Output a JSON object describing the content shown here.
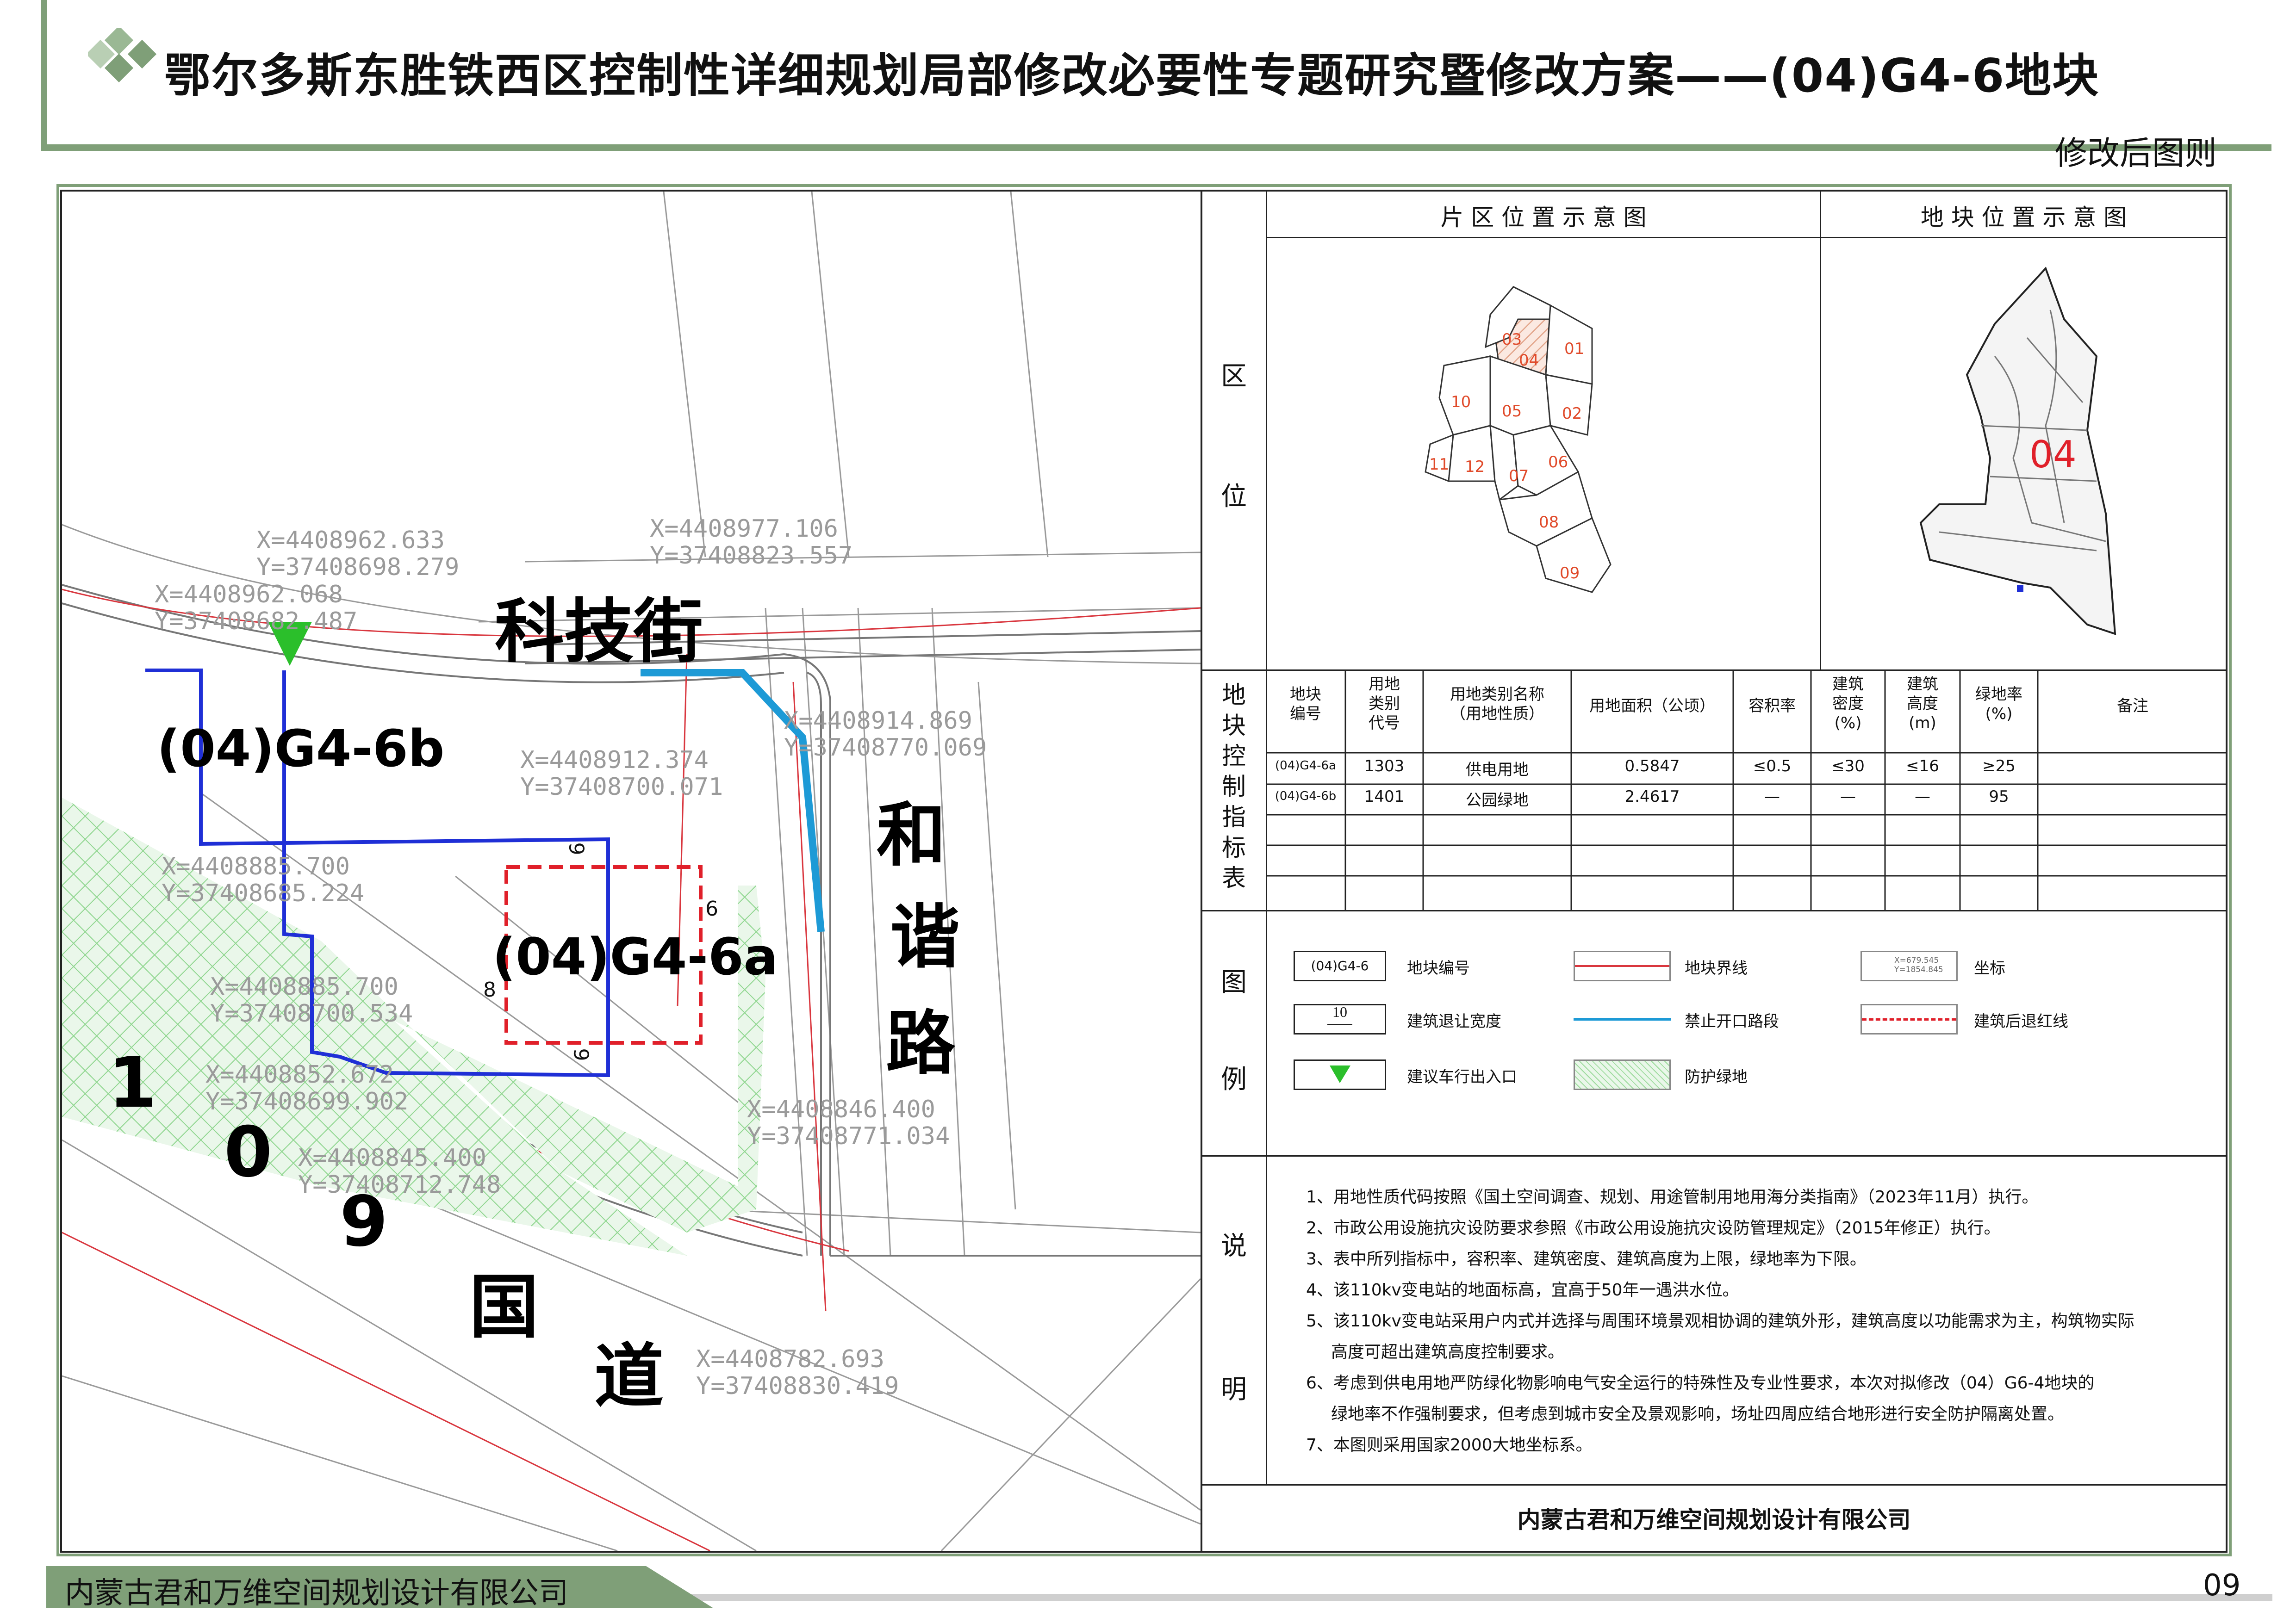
{
  "header": {
    "title": "鄂尔多斯东胜铁西区控制性详细规划局部修改必要性专题研究暨修改方案——(04)G4-6地块",
    "subtitle": "修改后图则"
  },
  "map": {
    "roads": {
      "keji": "科技街",
      "hexie": [
        "和",
        "谐",
        "路"
      ],
      "guodao": [
        "1",
        "0",
        "9",
        "国",
        "道"
      ]
    },
    "parcels": {
      "a": "(04)G4-6a",
      "b": "(04)G4-6b"
    },
    "setbacks": {
      "top": "6",
      "right": "6",
      "left": "8",
      "bottom": "6"
    },
    "coordinates": [
      {
        "x": "X=4408962.633",
        "y": "Y=37408698.279"
      },
      {
        "x": "X=4408977.106",
        "y": "Y=37408823.557"
      },
      {
        "x": "X=4408962.068",
        "y": "Y=37408682.487"
      },
      {
        "x": "X=4408914.869",
        "y": "Y=37408770.069"
      },
      {
        "x": "X=4408912.374",
        "y": "Y=37408700.071"
      },
      {
        "x": "X=4408885.700",
        "y": "Y=37408685.224"
      },
      {
        "x": "X=4408885.700",
        "y": "Y=37408700.534"
      },
      {
        "x": "X=4408852.672",
        "y": "Y=37408699.902"
      },
      {
        "x": "X=4408846.400",
        "y": "Y=37408771.034"
      },
      {
        "x": "X=4408845.400",
        "y": "Y=37408712.748"
      },
      {
        "x": "X=4408782.693",
        "y": "Y=37408830.419"
      }
    ]
  },
  "location": {
    "section_label": [
      "区",
      "位"
    ],
    "district_title": "片 区 位 置 示 意 图",
    "plot_title": "地 块 位 置 示 意 图",
    "district_zones": [
      "03",
      "04",
      "01",
      "10",
      "05",
      "02",
      "11",
      "12",
      "07",
      "06",
      "08",
      "09"
    ],
    "plot_zone": "04"
  },
  "control_table": {
    "section_label": [
      "地",
      "块",
      "控",
      "制",
      "指",
      "标",
      "表"
    ],
    "headers": [
      "地块\n编号",
      "用地\n类别\n代号",
      "用地类别名称\n（用地性质）",
      "用地面积（公顷）",
      "容积率",
      "建筑\n密度\n(%)",
      "建筑\n高度\n(m)",
      "绿地率\n(%)",
      "备注"
    ],
    "rows": [
      [
        "(04)G4-6a",
        "1303",
        "供电用地",
        "0.5847",
        "≤0.5",
        "≤30",
        "≤16",
        "≥25",
        ""
      ],
      [
        "(04)G4-6b",
        "1401",
        "公园绿地",
        "2.4617",
        "—",
        "—",
        "—",
        "95",
        ""
      ]
    ]
  },
  "legend": {
    "section_label": [
      "图",
      "例"
    ],
    "items": {
      "parcel_code_sample": "(04)G4-6",
      "parcel_code": "地块编号",
      "boundary": "地块界线",
      "coord_sample_x": "X=679.545",
      "coord_sample_y": "Y=1854.845",
      "coord": "坐标",
      "setback_sample": "10",
      "setback_width": "建筑退让宽度",
      "no_opening": "禁止开口路段",
      "setback_line": "建筑后退红线",
      "entrance": "建议车行出入口",
      "green": "防护绿地"
    },
    "colors": {
      "boundary": "#d9363e",
      "no_opening": "#1d9ad6",
      "setback": "#e0202a",
      "entrance": "#2bbf2b",
      "green": "#8fd68f",
      "parcel_line": "#1f2fd6"
    }
  },
  "notes": {
    "section_label": [
      "说",
      "明"
    ],
    "lines": [
      "1、用地性质代码按照《国土空间调查、规划、用途管制用地用海分类指南》（2023年11月）执行。",
      "2、市政公用设施抗灾设防要求参照《市政公用设施抗灾设防管理规定》（2015年修正）执行。",
      "3、表中所列指标中，容积率、建筑密度、建筑高度为上限，绿地率为下限。",
      "4、该110kv变电站的地面标高，宜高于50年一遇洪水位。",
      "5、该110kv变电站采用户内式并选择与周围环境景观相协调的建筑外形，建筑高度以功能需求为主，构筑物实际",
      "高度可超出建筑高度控制要求。",
      "6、考虑到供电用地严防绿化物影响电气安全运行的特殊性及专业性要求，本次对拟修改（04）G6-4地块的",
      "绿地率不作强制要求，但考虑到城市安全及景观影响，场址四周应结合地形进行安全防护隔离处置。",
      "7、本图则采用国家2000大地坐标系。"
    ]
  },
  "company_panel": "内蒙古君和万维空间规划设计有限公司",
  "footer": {
    "company": "内蒙古君和万维空间规划设计有限公司",
    "page": "09"
  }
}
